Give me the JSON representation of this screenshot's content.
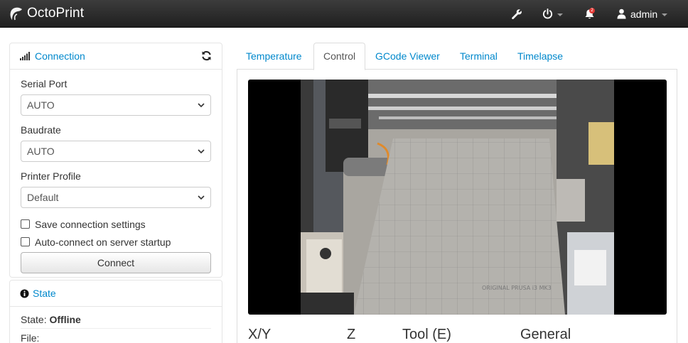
{
  "navbar": {
    "brand": "OctoPrint",
    "user": "admin",
    "notification_count": "2",
    "icons": [
      "settings-wrench-icon",
      "power-icon",
      "bell-icon",
      "user-icon"
    ]
  },
  "connection": {
    "title": "Connection",
    "serial_port": {
      "label": "Serial Port",
      "value": "AUTO"
    },
    "baudrate": {
      "label": "Baudrate",
      "value": "AUTO"
    },
    "printer_profile": {
      "label": "Printer Profile",
      "value": "Default"
    },
    "save_settings": {
      "label": "Save connection settings",
      "checked": false
    },
    "auto_connect": {
      "label": "Auto-connect on server startup",
      "checked": false
    },
    "connect_button": "Connect"
  },
  "state": {
    "title": "State",
    "state_label": "State:",
    "state_value": "Offline",
    "file_label": "File:"
  },
  "tabs": [
    {
      "label": "Temperature",
      "active": false
    },
    {
      "label": "Control",
      "active": true
    },
    {
      "label": "GCode Viewer",
      "active": false
    },
    {
      "label": "Terminal",
      "active": false
    },
    {
      "label": "Timelapse",
      "active": false
    }
  ],
  "control": {
    "webcam_bed_text": "ORIGINAL PRUSA i3 MK3",
    "columns": [
      "X/Y",
      "Z",
      "Tool (E)",
      "General"
    ]
  },
  "colors": {
    "link": "#0088cc",
    "navbar": "#2b2b2b",
    "border": "#dddddd"
  }
}
